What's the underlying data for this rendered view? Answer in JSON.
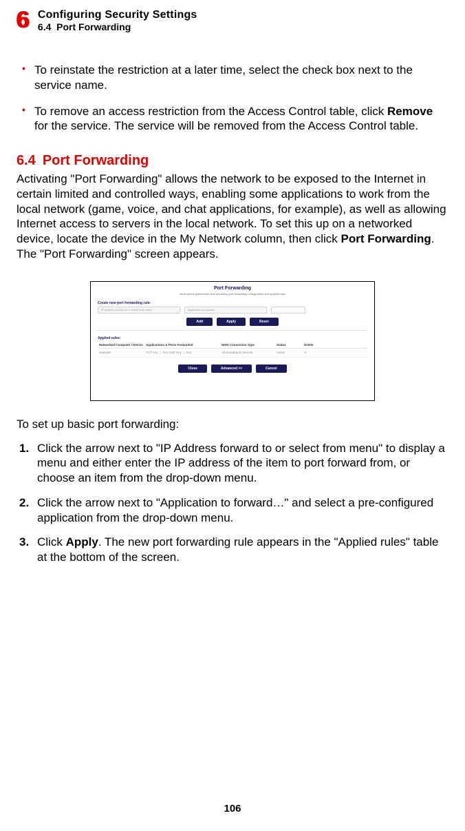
{
  "header": {
    "chapter_number": "6",
    "chapter_title": "Configuring Security Settings",
    "section_number_label": "6.4",
    "section_title_label": "Port Forwarding"
  },
  "bullets": [
    {
      "text": "To reinstate the restriction at a later time, select the check box next to the service name."
    },
    {
      "prefix": "To remove an access restriction from the Access Control table, click ",
      "bold": "Remove",
      "suffix": " for the service. The service will be removed from the Access Control table."
    }
  ],
  "section": {
    "number": "6.4",
    "title": "Port Forwarding"
  },
  "intro": {
    "prefix": "Activating \"Port Forwarding\" allows the network to be exposed to the Internet in certain limited and controlled ways, enabling some applications to work from the local network (game, voice, and chat applications, for example), as well as allowing Internet access to servers in the local network. To set this up on a networked device, locate the device in the My Network column, then click ",
    "bold": "Port Forwarding",
    "suffix": ". The \"Port Forwarding\" screen appears."
  },
  "figure": {
    "title": "Port Forwarding",
    "subtitle": "lorem ipsum placeholder text describing port forwarding configuration and applied rules",
    "rule_label": "Create new port forwarding rule:",
    "select1": "IP Address forward to or select from menu",
    "select2": "Application to forward...",
    "btn_add": "Add",
    "btn_apply": "Apply",
    "btn_reset": "Reset",
    "applied_label": "Applied rules:",
    "th": [
      "Networked Computer / Device",
      "Applications & Ports Forwarded",
      "WAN Connection Type",
      "Status",
      "Delete"
    ],
    "td": [
      "example",
      "⎯",
      "TCP Any → Any UDP Any → Any",
      "All Broadband Devices",
      "Active",
      "✕"
    ],
    "btn_close": "Close",
    "btn_apply2": "Advanced >>",
    "btn_cancel": "Cancel"
  },
  "setup_intro": "To set up basic port forwarding:",
  "steps": [
    {
      "text": "Click the arrow next to \"IP Address forward to or select from menu\" to display a menu and either enter the IP address of the item to port forward from, or choose an item from the drop-down menu."
    },
    {
      "text": "Click the arrow next to \"Application to forward…\" and select a pre-configured application from the drop-down menu."
    },
    {
      "prefix": "Click ",
      "bold": "Apply",
      "suffix": ". The new port forwarding rule appears in the \"Applied rules\" table at the bottom of the screen."
    }
  ],
  "page_number": "106"
}
